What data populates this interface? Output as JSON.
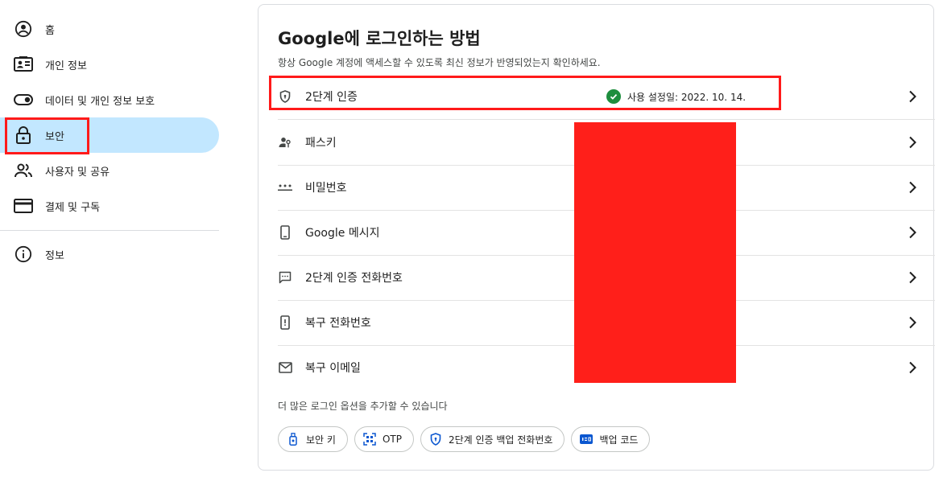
{
  "sidebar": {
    "items": [
      {
        "label": "홈"
      },
      {
        "label": "개인 정보"
      },
      {
        "label": "데이터 및 개인 정보 보호"
      },
      {
        "label": "보안"
      },
      {
        "label": "사용자 및 공유"
      },
      {
        "label": "결제 및 구독"
      },
      {
        "label": "정보"
      }
    ],
    "active_index": 3
  },
  "main": {
    "title": "Google에 로그인하는 방법",
    "description": "항상 Google 계정에 액세스할 수 있도록 최신 정보가 반영되었는지 확인하세요.",
    "rows": [
      {
        "label": "2단계 인증",
        "icon": "shield-icon",
        "status": "사용 설정일: 2022. 10. 14."
      },
      {
        "label": "패스키",
        "icon": "person-key-icon"
      },
      {
        "label": "비밀번호",
        "icon": "password-dots-icon"
      },
      {
        "label": "Google 메시지",
        "icon": "phone-icon"
      },
      {
        "label": "2단계 인증 전화번호",
        "icon": "message-icon"
      },
      {
        "label": "복구 전화번호",
        "icon": "phone-alert-icon"
      },
      {
        "label": "복구 이메일",
        "icon": "mail-icon"
      }
    ],
    "more_options_text": "더 많은 로그인 옵션을 추가할 수 있습니다",
    "chips": [
      {
        "label": "보안 키",
        "icon": "usb-key-icon"
      },
      {
        "label": "OTP",
        "icon": "qr-scan-icon"
      },
      {
        "label": "2단계 인증 백업 전화번호",
        "icon": "shield-icon"
      },
      {
        "label": "백업 코드",
        "icon": "code-123-icon"
      }
    ]
  },
  "colors": {
    "active_nav": "#c2e7ff",
    "highlight": "#ff1a1a",
    "success": "#1e8e3e",
    "redaction": "#ff1f1a"
  }
}
